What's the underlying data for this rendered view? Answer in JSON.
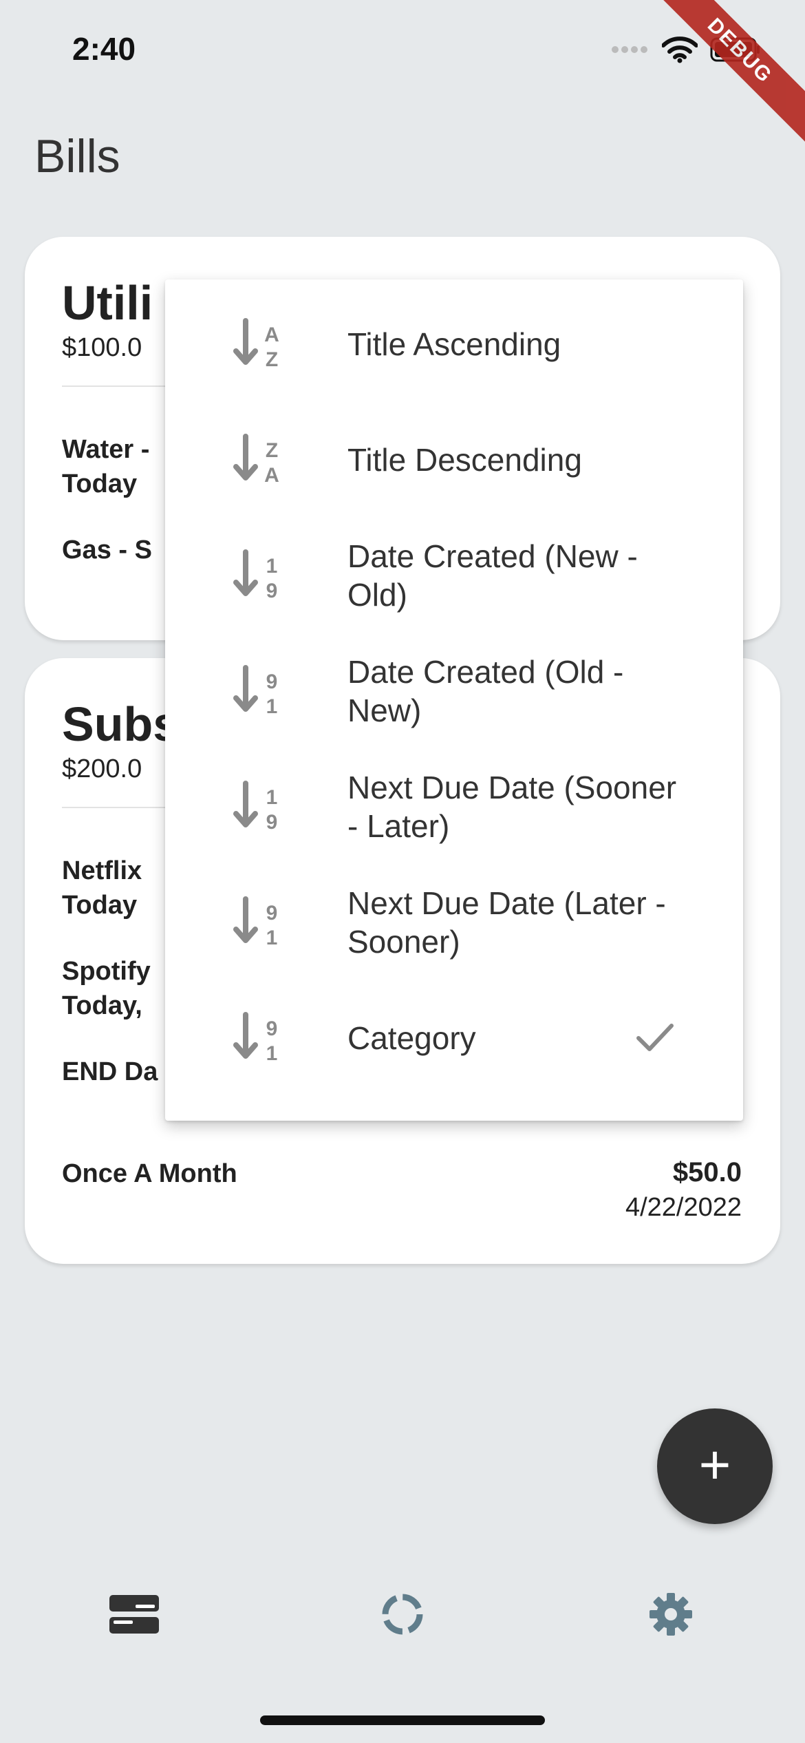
{
  "status_bar": {
    "time": "2:40",
    "debug_label": "DEBUG"
  },
  "page": {
    "title": "Bills"
  },
  "cards": [
    {
      "title": "Utili",
      "total": "$100.0",
      "rows": [
        {
          "label_line1": "Water -",
          "label_line2": "Today"
        },
        {
          "label_line1": "Gas - S",
          "label_line2": ""
        }
      ]
    },
    {
      "title": "Subs",
      "total": "$200.0",
      "rows": [
        {
          "label_line1": "Netflix",
          "label_line2": "Today"
        },
        {
          "label_line1": "Spotify",
          "label_line2": "Today,"
        },
        {
          "label_line1": "END Da",
          "label_line2": ""
        },
        {
          "label_line1": "Once A Month",
          "label_line2": "",
          "amount": "$50.0",
          "date": "4/22/2022"
        }
      ]
    }
  ],
  "sort_menu": {
    "items": [
      {
        "label": "Title Ascending",
        "icon": "sort-alpha-asc-icon",
        "glyph_top": "A",
        "glyph_bottom": "Z"
      },
      {
        "label": "Title Descending",
        "icon": "sort-alpha-desc-icon",
        "glyph_top": "Z",
        "glyph_bottom": "A"
      },
      {
        "label": "Date Created (New - Old)",
        "icon": "sort-numeric-asc-icon",
        "glyph_top": "1",
        "glyph_bottom": "9"
      },
      {
        "label": "Date Created (Old - New)",
        "icon": "sort-numeric-desc-icon",
        "glyph_top": "9",
        "glyph_bottom": "1"
      },
      {
        "label": "Next Due Date (Sooner - Later)",
        "icon": "sort-numeric-asc-icon",
        "glyph_top": "1",
        "glyph_bottom": "9"
      },
      {
        "label": "Next Due Date (Later - Sooner)",
        "icon": "sort-numeric-desc-icon",
        "glyph_top": "9",
        "glyph_bottom": "1"
      },
      {
        "label": "Category",
        "icon": "sort-numeric-desc-icon",
        "glyph_top": "9",
        "glyph_bottom": "1",
        "selected": true
      }
    ]
  },
  "fab": {
    "label": "+"
  },
  "bottom_nav": [
    {
      "icon": "bills-list-icon"
    },
    {
      "icon": "loading-ring-icon"
    },
    {
      "icon": "settings-gear-icon"
    }
  ],
  "colors": {
    "background": "#e6e9eb",
    "card": "#ffffff",
    "icon_gray": "#8a8a8a",
    "fab": "#333333",
    "nav_gray": "#607d8b",
    "debug": "#b3261e"
  }
}
